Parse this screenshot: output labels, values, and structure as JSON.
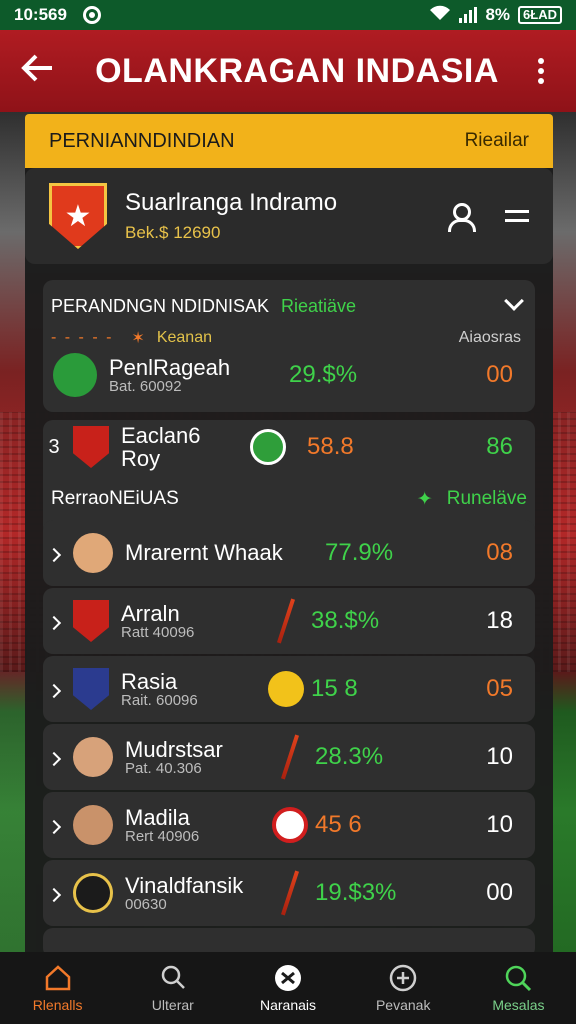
{
  "status": {
    "time": "10:569",
    "battery": "8%",
    "right_text": "6ŁAD"
  },
  "appbar": {
    "title": "OLANKRAGAN INDASIA"
  },
  "banner": {
    "left": "PERNIANNDINDIAN",
    "right": "Rieailar"
  },
  "team": {
    "name": "Suarlranga Indramo",
    "sub": "Bek.$ 12690"
  },
  "standing": {
    "head_left": "PERANDNGN NDIDNISAK",
    "head_right": "Rieatiäve",
    "sub_label": "Keanan",
    "sub_right": "Aiaosras",
    "row": {
      "name": "PenlRageah",
      "sub": "Bat. 60092",
      "pct": "29.$%",
      "val": "00"
    }
  },
  "row3": {
    "rank": "3",
    "name": "Eaclan6 Roy",
    "pct": "58.8",
    "val": "86"
  },
  "section2": {
    "left": "RerraoNEiUAS",
    "right": "Runeläve"
  },
  "players": [
    {
      "name": "Mrarernt Whaak",
      "sub": "",
      "pct": "77.9%",
      "val": "08",
      "val_color": "orange"
    },
    {
      "name": "Arraln",
      "sub": "Ratt 40096",
      "pct": "38.$%",
      "val": "18",
      "val_color": "white"
    },
    {
      "name": "Rasia",
      "sub": "Rait. 60096",
      "pct": "15 8",
      "val": "05",
      "val_color": "orange"
    },
    {
      "name": "Mudrstsar",
      "sub": "Pat. 40.306",
      "pct": "28.3%",
      "val": "10",
      "val_color": "white"
    },
    {
      "name": "Madila",
      "sub": "Rert 40906",
      "pct": "45 6",
      "val": "10",
      "val_color": "white"
    },
    {
      "name": "Vinaldfansik",
      "sub": "00630",
      "pct": "19.$3%",
      "val": "00",
      "val_color": "white"
    }
  ],
  "nav": [
    {
      "label": "Rlenalls",
      "icon": "home-icon"
    },
    {
      "label": "Ulterar",
      "icon": "search-person-icon"
    },
    {
      "label": "Naranais",
      "icon": "ball-icon"
    },
    {
      "label": "Pevanak",
      "icon": "add-circle-icon"
    },
    {
      "label": "Mesalas",
      "icon": "search-icon"
    }
  ],
  "colors": {
    "accent_red": "#b01c22",
    "accent_yellow": "#f2b21a",
    "accent_green": "#3fd24a",
    "accent_orange": "#f2792a"
  }
}
